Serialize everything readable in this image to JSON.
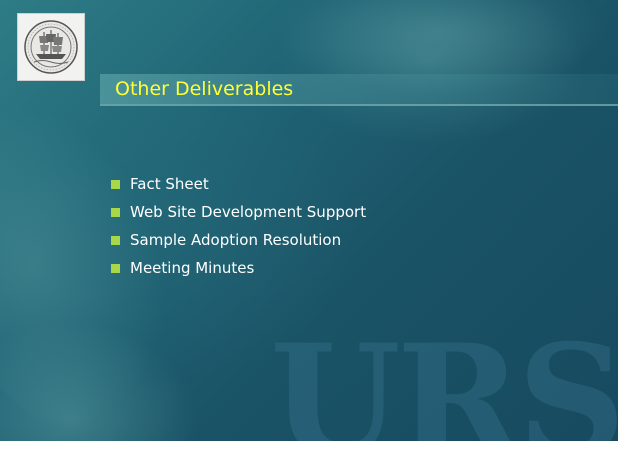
{
  "slide": {
    "title": "Other Deliverables",
    "bullets": [
      "Fact Sheet",
      "Web Site Development Support",
      "Sample Adoption Resolution",
      "Meeting Minutes"
    ],
    "watermark_text": "URS",
    "logo_icon": "ship-seal-icon"
  },
  "colors": {
    "background": "#1f6374",
    "title": "#ffff33",
    "bullet_text": "#ffffff",
    "bullet_marker": "#a8d84a"
  }
}
